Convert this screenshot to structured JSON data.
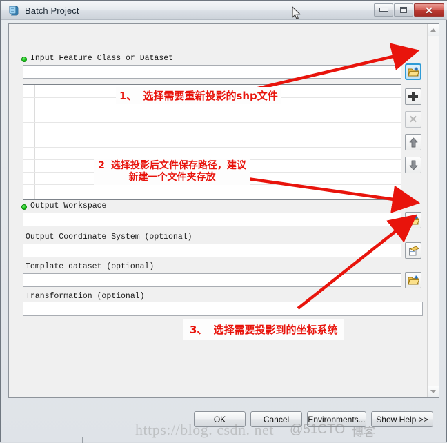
{
  "window": {
    "title": "Batch Project",
    "icon": "script-tool-icon",
    "controls": {
      "minimize": "Minimize",
      "maximize": "Maximize",
      "close": "Close"
    }
  },
  "form": {
    "fields": [
      {
        "label": "Input Feature Class or Dataset",
        "required": true,
        "value": "",
        "browse_icon": "open-folder-add-icon"
      },
      {
        "label": "Output Workspace",
        "required": true,
        "value": "",
        "browse_icon": "open-folder-add-icon"
      },
      {
        "label": "Output Coordinate System (optional)",
        "required": false,
        "value": "",
        "browse_icon": "coordinate-system-icon"
      },
      {
        "label": "Template dataset (optional)",
        "required": false,
        "value": "",
        "browse_icon": "open-folder-add-icon"
      },
      {
        "label": "Transformation (optional)",
        "required": false,
        "value": "",
        "browse_icon": ""
      }
    ],
    "list_tools": [
      {
        "name": "browse-button",
        "icon": "open-folder-add-icon",
        "state": "selected"
      },
      {
        "name": "add-button",
        "icon": "plus-icon",
        "state": "enabled"
      },
      {
        "name": "remove-button",
        "icon": "x-icon",
        "state": "disabled"
      },
      {
        "name": "move-up-button",
        "icon": "arrow-up-icon",
        "state": "enabled"
      },
      {
        "name": "move-down-button",
        "icon": "arrow-down-icon",
        "state": "enabled"
      }
    ],
    "list_items": []
  },
  "buttons": {
    "ok": "OK",
    "cancel": "Cancel",
    "environments": "Environments...",
    "show_help": "Show Help >>"
  },
  "annotations": [
    {
      "number": "1、",
      "text": "选择需要重新投影的shp文件"
    },
    {
      "number": "2",
      "text": "选择投影后文件保存路径，建议新建一个文件夹存放"
    },
    {
      "number": "3、",
      "text": "选择需要投影到的坐标系统"
    }
  ],
  "watermark": {
    "url": "https://blog. csdn. net",
    "at": "@51CTO",
    "suffix": "博客"
  },
  "colors": {
    "annotation_red": "#e8140c",
    "required_dot_green": "#16c016",
    "selection_blue": "#2e9bd6",
    "close_button_red": "#bc3b33"
  },
  "scrollbar": {
    "up_arrow": "scroll-up-icon",
    "down_arrow": "scroll-down-icon"
  }
}
